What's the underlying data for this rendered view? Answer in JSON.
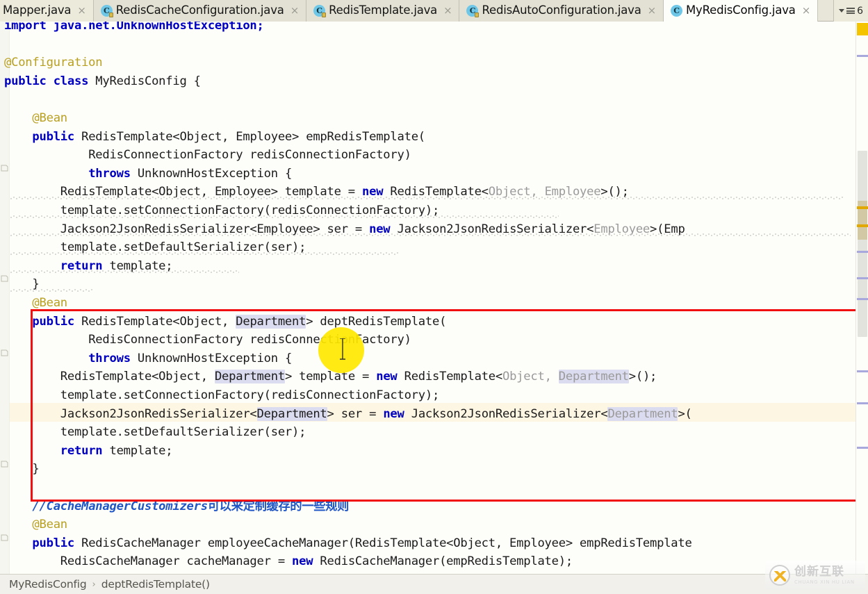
{
  "window": {
    "app": "IntelliJ IDEA Editor",
    "active_file": "MyRedisConfig.java"
  },
  "tabs": {
    "items": [
      {
        "label": "Mapper.java",
        "icon": "java-class-icon",
        "active": false,
        "has_icon": false,
        "close": "×"
      },
      {
        "label": "RedisCacheConfiguration.java",
        "icon": "java-class-icon",
        "active": false,
        "has_icon": true,
        "close": "×"
      },
      {
        "label": "RedisTemplate.java",
        "icon": "java-class-icon",
        "active": false,
        "has_icon": true,
        "close": "×"
      },
      {
        "label": "RedisAutoConfiguration.java",
        "icon": "java-class-icon",
        "active": false,
        "has_icon": true,
        "close": "×"
      },
      {
        "label": "MyRedisConfig.java",
        "icon": "java-class-icon",
        "active": true,
        "has_icon": true,
        "close": "×"
      }
    ],
    "icon_letter": "C",
    "overflow_count": "6"
  },
  "code": {
    "lines": [
      {
        "indent": 0,
        "tokens": [
          {
            "t": "import java.net.UnknownHostException;",
            "c": "kw-import-cut"
          }
        ]
      },
      {
        "indent": 0,
        "tokens": []
      },
      {
        "indent": 0,
        "tokens": [
          {
            "t": "@Configuration",
            "c": "ann"
          }
        ]
      },
      {
        "indent": 0,
        "tokens": [
          {
            "t": "public",
            "c": "kw"
          },
          {
            "t": " ",
            "c": "plain"
          },
          {
            "t": "class",
            "c": "kw"
          },
          {
            "t": " MyRedisConfig {",
            "c": "plain"
          }
        ]
      },
      {
        "indent": 0,
        "tokens": []
      },
      {
        "indent": 1,
        "tokens": [
          {
            "t": "@Bean",
            "c": "ann"
          }
        ]
      },
      {
        "indent": 1,
        "tokens": [
          {
            "t": "public",
            "c": "kw"
          },
          {
            "t": " RedisTemplate<Object, Employee> empRedisTemplate(",
            "c": "plain"
          }
        ]
      },
      {
        "indent": 2,
        "tokens": [
          {
            "t": "    RedisConnectionFactory redisConnectionFactory)",
            "c": "plain"
          }
        ]
      },
      {
        "indent": 2,
        "tokens": [
          {
            "t": "    ",
            "c": "plain"
          },
          {
            "t": "throws",
            "c": "kw"
          },
          {
            "t": " UnknownHostException {",
            "c": "plain"
          }
        ]
      },
      {
        "indent": 2,
        "tokens": [
          {
            "t": "RedisTemplate<Object, Employee> template = ",
            "c": "plain"
          },
          {
            "t": "new",
            "c": "kw"
          },
          {
            "t": " RedisTemplate<",
            "c": "plain"
          },
          {
            "t": "Object, Employee",
            "c": "gen"
          },
          {
            "t": ">();",
            "c": "plain"
          }
        ]
      },
      {
        "indent": 2,
        "tokens": [
          {
            "t": "template.setConnectionFactory(redisConnectionFactory);",
            "c": "plain"
          }
        ]
      },
      {
        "indent": 2,
        "tokens": [
          {
            "t": "Jackson2JsonRedisSerializer<Employee> ser = ",
            "c": "plain"
          },
          {
            "t": "new",
            "c": "kw"
          },
          {
            "t": " Jackson2JsonRedisSerializer<",
            "c": "plain"
          },
          {
            "t": "Employee",
            "c": "gen"
          },
          {
            "t": ">(Emp",
            "c": "plain"
          }
        ]
      },
      {
        "indent": 2,
        "tokens": [
          {
            "t": "template.setDefaultSerializer(ser);",
            "c": "plain"
          }
        ]
      },
      {
        "indent": 2,
        "tokens": [
          {
            "t": "return",
            "c": "kw"
          },
          {
            "t": " template;",
            "c": "plain"
          }
        ]
      },
      {
        "indent": 1,
        "tokens": [
          {
            "t": "}",
            "c": "plain"
          }
        ]
      },
      {
        "indent": 1,
        "tokens": [
          {
            "t": "@Bean",
            "c": "ann"
          }
        ]
      },
      {
        "indent": 1,
        "tokens": [
          {
            "t": "public",
            "c": "kw"
          },
          {
            "t": " RedisTemplate<Object, ",
            "c": "plain"
          },
          {
            "t": "Department",
            "c": "ident-hl"
          },
          {
            "t": "> deptRedisTemplate(",
            "c": "plain"
          }
        ]
      },
      {
        "indent": 2,
        "tokens": [
          {
            "t": "    RedisConnectionFactory redisConnectionFactory)",
            "c": "plain"
          }
        ]
      },
      {
        "indent": 2,
        "tokens": [
          {
            "t": "    ",
            "c": "plain"
          },
          {
            "t": "throws",
            "c": "kw"
          },
          {
            "t": " UnknownHostException {",
            "c": "plain"
          }
        ]
      },
      {
        "indent": 2,
        "tokens": [
          {
            "t": "RedisTemplate<Object, ",
            "c": "plain"
          },
          {
            "t": "Department",
            "c": "ident-hl"
          },
          {
            "t": "> template = ",
            "c": "plain"
          },
          {
            "t": "new",
            "c": "kw"
          },
          {
            "t": " RedisTemplate<",
            "c": "plain"
          },
          {
            "t": "Object, ",
            "c": "gen"
          },
          {
            "t": "Department",
            "c": "gen-hl"
          },
          {
            "t": ">();",
            "c": "plain"
          }
        ]
      },
      {
        "indent": 2,
        "tokens": [
          {
            "t": "template.setConnectionFactory(redisConnectionFactory);",
            "c": "plain"
          }
        ]
      },
      {
        "indent": 2,
        "tokens": [
          {
            "t": "Jackson2JsonRedisSerializer<",
            "c": "plain"
          },
          {
            "t": "Department",
            "c": "ident-hl"
          },
          {
            "t": "> ser = ",
            "c": "plain"
          },
          {
            "t": "new",
            "c": "kw"
          },
          {
            "t": " Jackson2JsonRedisSerializer<",
            "c": "plain"
          },
          {
            "t": "Department",
            "c": "gen-hl"
          },
          {
            "t": ">(",
            "c": "plain"
          }
        ]
      },
      {
        "indent": 2,
        "tokens": [
          {
            "t": "template.setDefaultSerializer(ser);",
            "c": "plain"
          }
        ]
      },
      {
        "indent": 2,
        "tokens": [
          {
            "t": "return",
            "c": "kw"
          },
          {
            "t": " template;",
            "c": "plain"
          }
        ]
      },
      {
        "indent": 1,
        "tokens": [
          {
            "t": "}",
            "c": "plain"
          }
        ]
      },
      {
        "indent": 0,
        "tokens": []
      },
      {
        "indent": 1,
        "tokens": [
          {
            "t": "//CacheManagerCustomizers",
            "c": "cmt"
          },
          {
            "t": "可以来定制缓存的一些规则",
            "c": "cmt-cn"
          }
        ]
      },
      {
        "indent": 1,
        "tokens": [
          {
            "t": "@Bean",
            "c": "ann"
          }
        ]
      },
      {
        "indent": 1,
        "tokens": [
          {
            "t": "public",
            "c": "kw"
          },
          {
            "t": " RedisCacheManager employeeCacheManager(RedisTemplate<Object, Employee> empRedisTemplate",
            "c": "plain"
          }
        ]
      },
      {
        "indent": 2,
        "tokens": [
          {
            "t": "RedisCacheManager cacheManager = ",
            "c": "plain"
          },
          {
            "t": "new",
            "c": "kw"
          },
          {
            "t": " RedisCacheManager(empRedisTemplate);",
            "c": "plain"
          }
        ]
      }
    ]
  },
  "annotations": {
    "red_box_color": "#f20f0f",
    "cursor_highlight_color": "#ffe800",
    "current_line_color": "#fdf6e3",
    "identifier_highlight_color": "#dcdcf0"
  },
  "breadcrumb": {
    "items": [
      "MyRedisConfig",
      "deptRedisTemplate()"
    ],
    "separator": "›"
  },
  "watermark": {
    "cn": "创新互联",
    "en": "CHUANG XIN HU LIAN"
  }
}
